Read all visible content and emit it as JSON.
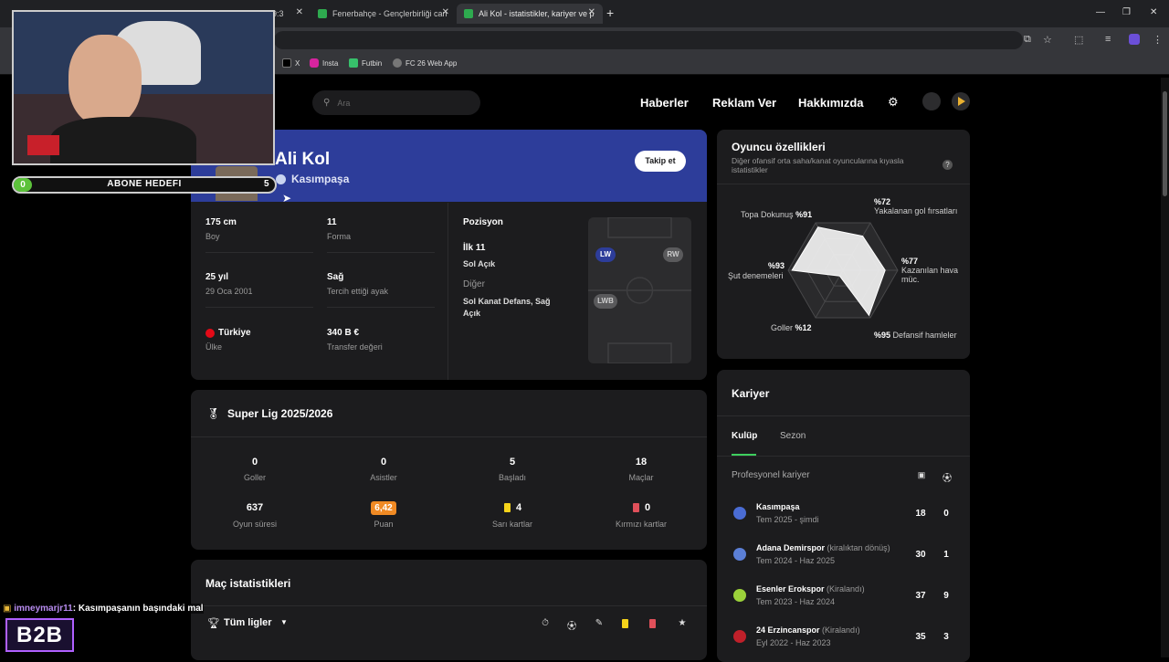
{
  "browser": {
    "tabs": [
      {
        "title": "9:3"
      },
      {
        "title": "Fenerbahçe - Gençlerbirliği can"
      },
      {
        "title": "Ali Kol - istatistikler, kariyer ve p"
      }
    ],
    "new_tab": "+",
    "bookmarks": [
      "X",
      "Insta",
      "Futbin",
      "FC 26 Web App"
    ]
  },
  "site": {
    "search_placeholder": "Ara",
    "nav": [
      "Haberler",
      "Reklam Ver",
      "Hakkımızda"
    ]
  },
  "player": {
    "name": "Ali Kol",
    "club": "Kasımpaşa",
    "follow": "Takip et",
    "height_value": "175 cm",
    "height_label": "Boy",
    "shirt_value": "11",
    "shirt_label": "Forma",
    "age_value": "25 yıl",
    "age_sub": "29 Oca 2001",
    "foot_value": "Sağ",
    "foot_label": "Tercih ettiği ayak",
    "country_value": "Türkiye",
    "country_label": "Ülke",
    "market_value": "340 B €",
    "market_label": "Transfer değeri",
    "position_title": "Pozisyon",
    "first11_label": "İlk 11",
    "first11_value": "Sol Açık",
    "other_label": "Diğer",
    "other_value": "Sol Kanat Defans, Sağ Açık",
    "pitch_tags": [
      "LW",
      "RW",
      "LWB"
    ]
  },
  "attributes": {
    "title": "Oyuncu özellikleri",
    "subtitle": "Diğer ofansif orta saha/kanat oyuncularına kıyasla istatistikler",
    "help": "?",
    "items": [
      {
        "pct": "%91",
        "label": "Topa Dokunuş"
      },
      {
        "pct": "%72",
        "label": "Yakalanan gol fırsatları"
      },
      {
        "pct": "%77",
        "label": "Kazanılan hava müc."
      },
      {
        "pct": "%95",
        "label": "Defansif hamleler"
      },
      {
        "pct": "%12",
        "label": "Goller"
      },
      {
        "pct": "%93",
        "label": "Şut denemeleri"
      }
    ],
    "values": [
      0.91,
      0.72,
      0.77,
      0.95,
      0.12,
      0.93
    ]
  },
  "season": {
    "title": "Super Lig 2025/2026",
    "stats": [
      {
        "value": "0",
        "label": "Goller"
      },
      {
        "value": "0",
        "label": "Asistler"
      },
      {
        "value": "5",
        "label": "Başladı"
      },
      {
        "value": "18",
        "label": "Maçlar"
      },
      {
        "value": "637",
        "label": "Oyun süresi"
      },
      {
        "value": "6,42",
        "label": "Puan"
      },
      {
        "value": "4",
        "label": "Sarı kartlar"
      },
      {
        "value": "0",
        "label": "Kırmızı kartlar"
      }
    ]
  },
  "match_stats": {
    "title": "Maç istatistikleri",
    "filter": "Tüm ligler"
  },
  "career": {
    "title": "Kariyer",
    "tabs": [
      "Kulüp",
      "Sezon"
    ],
    "section": "Profesyonel kariyer",
    "clubs": [
      {
        "name": "Kasımpaşa",
        "note": "",
        "period": "Tem 2025 - şimdi",
        "apps": "18",
        "goals": "0",
        "color": "#4a6cd4"
      },
      {
        "name": "Adana Demirspor",
        "note": "(kiralıktan dönüş)",
        "period": "Tem 2024 - Haz 2025",
        "apps": "30",
        "goals": "1",
        "color": "#5b7fd6"
      },
      {
        "name": "Esenler Erokspor",
        "note": "(Kiralandı)",
        "period": "Tem 2023 - Haz 2024",
        "apps": "37",
        "goals": "9",
        "color": "#9bd13a"
      },
      {
        "name": "24 Erzincanspor",
        "note": "(Kiralandı)",
        "period": "Eyl 2022 - Haz 2023",
        "apps": "35",
        "goals": "3",
        "color": "#c0202a"
      }
    ]
  },
  "overlay": {
    "goal_label": "ABONE HEDEFI",
    "goal_current": "0",
    "goal_target": "5",
    "chat_user": "imneymarjr11",
    "chat_message": ": Kasımpaşanın başındaki mal",
    "logo": "B2B"
  }
}
